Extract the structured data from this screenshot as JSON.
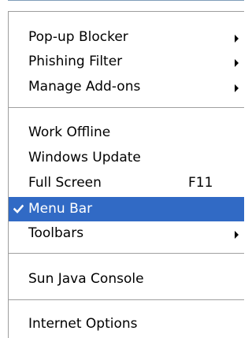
{
  "menu": {
    "groups": [
      {
        "items": [
          {
            "label": "Pop-up Blocker",
            "submenu": true
          },
          {
            "label": "Phishing Filter",
            "submenu": true
          },
          {
            "label": "Manage Add-ons",
            "submenu": true
          }
        ]
      },
      {
        "items": [
          {
            "label": "Work Offline"
          },
          {
            "label": "Windows Update"
          },
          {
            "label": "Full Screen",
            "shortcut": "F11"
          },
          {
            "label": "Menu Bar",
            "checked": true,
            "selected": true
          },
          {
            "label": "Toolbars",
            "submenu": true
          }
        ]
      },
      {
        "items": [
          {
            "label": "Sun Java Console"
          }
        ]
      },
      {
        "items": [
          {
            "label": "Internet Options"
          }
        ]
      }
    ]
  },
  "colors": {
    "highlight": "#316ac5",
    "highlight_text": "#ffffff",
    "text": "#000000",
    "separator": "#a0a0a0"
  },
  "icons": {
    "check": "checkmark-icon",
    "submenu": "submenu-arrow-icon"
  }
}
